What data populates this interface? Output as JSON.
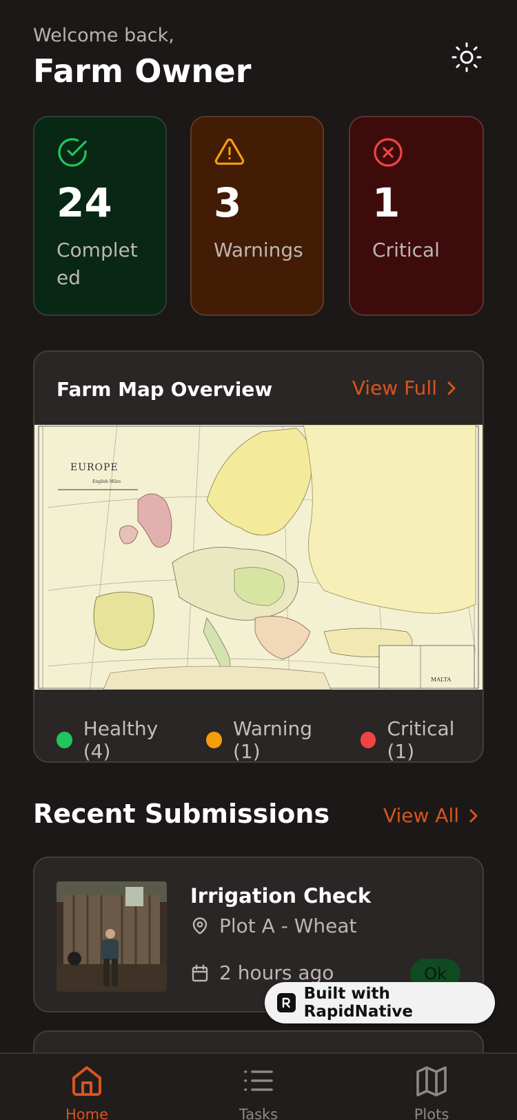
{
  "header": {
    "welcome": "Welcome back,",
    "title": "Farm Owner",
    "theme_icon": "sun-icon"
  },
  "stats": [
    {
      "value": "24",
      "label": "Completed",
      "icon": "check-circle-icon",
      "color": "#22c55e"
    },
    {
      "value": "3",
      "label": "Warnings",
      "icon": "warning-triangle-icon",
      "color": "#f59e0b"
    },
    {
      "value": "1",
      "label": "Critical",
      "icon": "x-circle-icon",
      "color": "#ef4444"
    }
  ],
  "map": {
    "title": "Farm Map Overview",
    "view_full": "View Full",
    "legend": [
      {
        "label": "Healthy (4)",
        "color": "#22c55e"
      },
      {
        "label": "Warning (1)",
        "color": "#f59e0b"
      },
      {
        "label": "Critical (1)",
        "color": "#ef4444"
      }
    ],
    "map_labels": {
      "region": "EUROPE",
      "scale": "English Miles",
      "inset": "MALTA"
    }
  },
  "recent": {
    "title": "Recent Submissions",
    "view_all": "View All",
    "items": [
      {
        "title": "Irrigation Check",
        "location": "Plot A - Wheat",
        "time": "2 hours ago",
        "status": "Ok"
      }
    ]
  },
  "badge": {
    "text": "Built with RapidNative"
  },
  "nav": {
    "home": "Home",
    "tasks": "Tasks",
    "plots": "Plots"
  },
  "colors": {
    "accent": "#d9541e",
    "background": "#1c1817",
    "card": "#2a2625"
  }
}
